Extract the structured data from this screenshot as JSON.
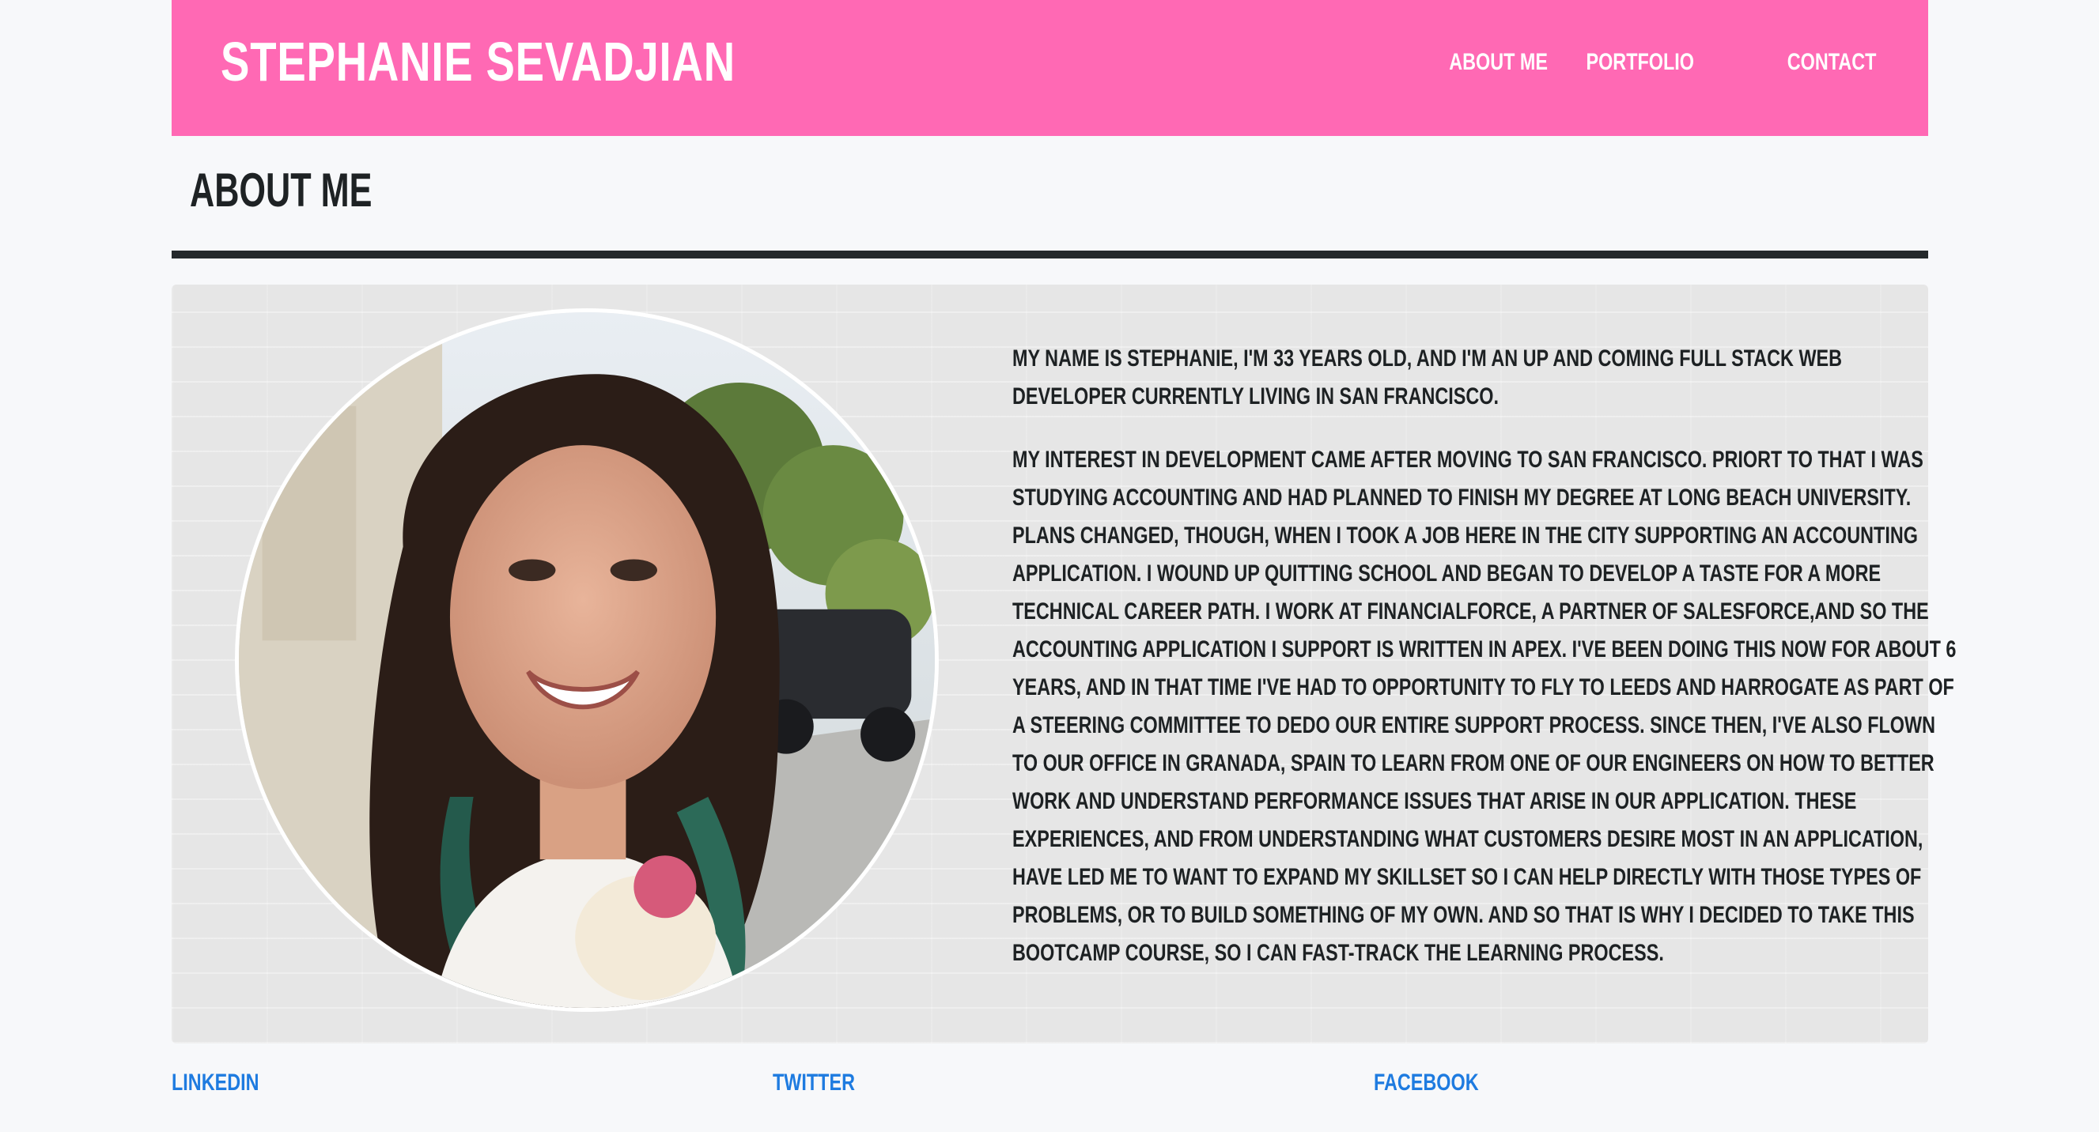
{
  "header": {
    "site_title": "STEPHANIE SEVADJIAN",
    "nav": [
      "ABOUT ME",
      "PORTFOLIO",
      "CONTACT"
    ]
  },
  "main": {
    "section_title": "ABOUT ME",
    "photo_alt": "Portrait of Stephanie",
    "paragraphs": [
      "My name is Stephanie, I'm 33 years old, and I'm an up and coming full stack web developer currently living in San Francisco.",
      "My interest in development came after moving to San Francisco. Priort to that I was studying accounting and had planned to finish my degree at Long Beach University. Plans changed, though, when I took a job here in the city supporting an accounting application. I wound up quitting school and began to develop a taste for a more technical career path. I work at FinancialForce, a partner of Salesforce,and so the accounting application I support is written in Apex. I've been doing this now for about 6 years, and in that time I've had to opportunity to fly to Leeds and Harrogate as part of a steering committee to dedo our entire support process. Since then, I've also flown to our office in Granada, Spain to learn from one of our engineers on how to better work and understand performance issues that arise in our application. These experiences, and from understanding what customers desire most in an application, have led me to want to expand my skillset so I can help directly with those types of problems, or to build something of my own. And so that is why I decided to take this bootcamp course, so I can fast-track the learning process."
    ]
  },
  "footer": {
    "links": [
      "LINKEDIN",
      "TWITTER",
      "FACEBOOK"
    ]
  },
  "colors": {
    "header_bg": "#ff69b4",
    "link": "#1e7be0",
    "text_dark": "#1e2224"
  }
}
